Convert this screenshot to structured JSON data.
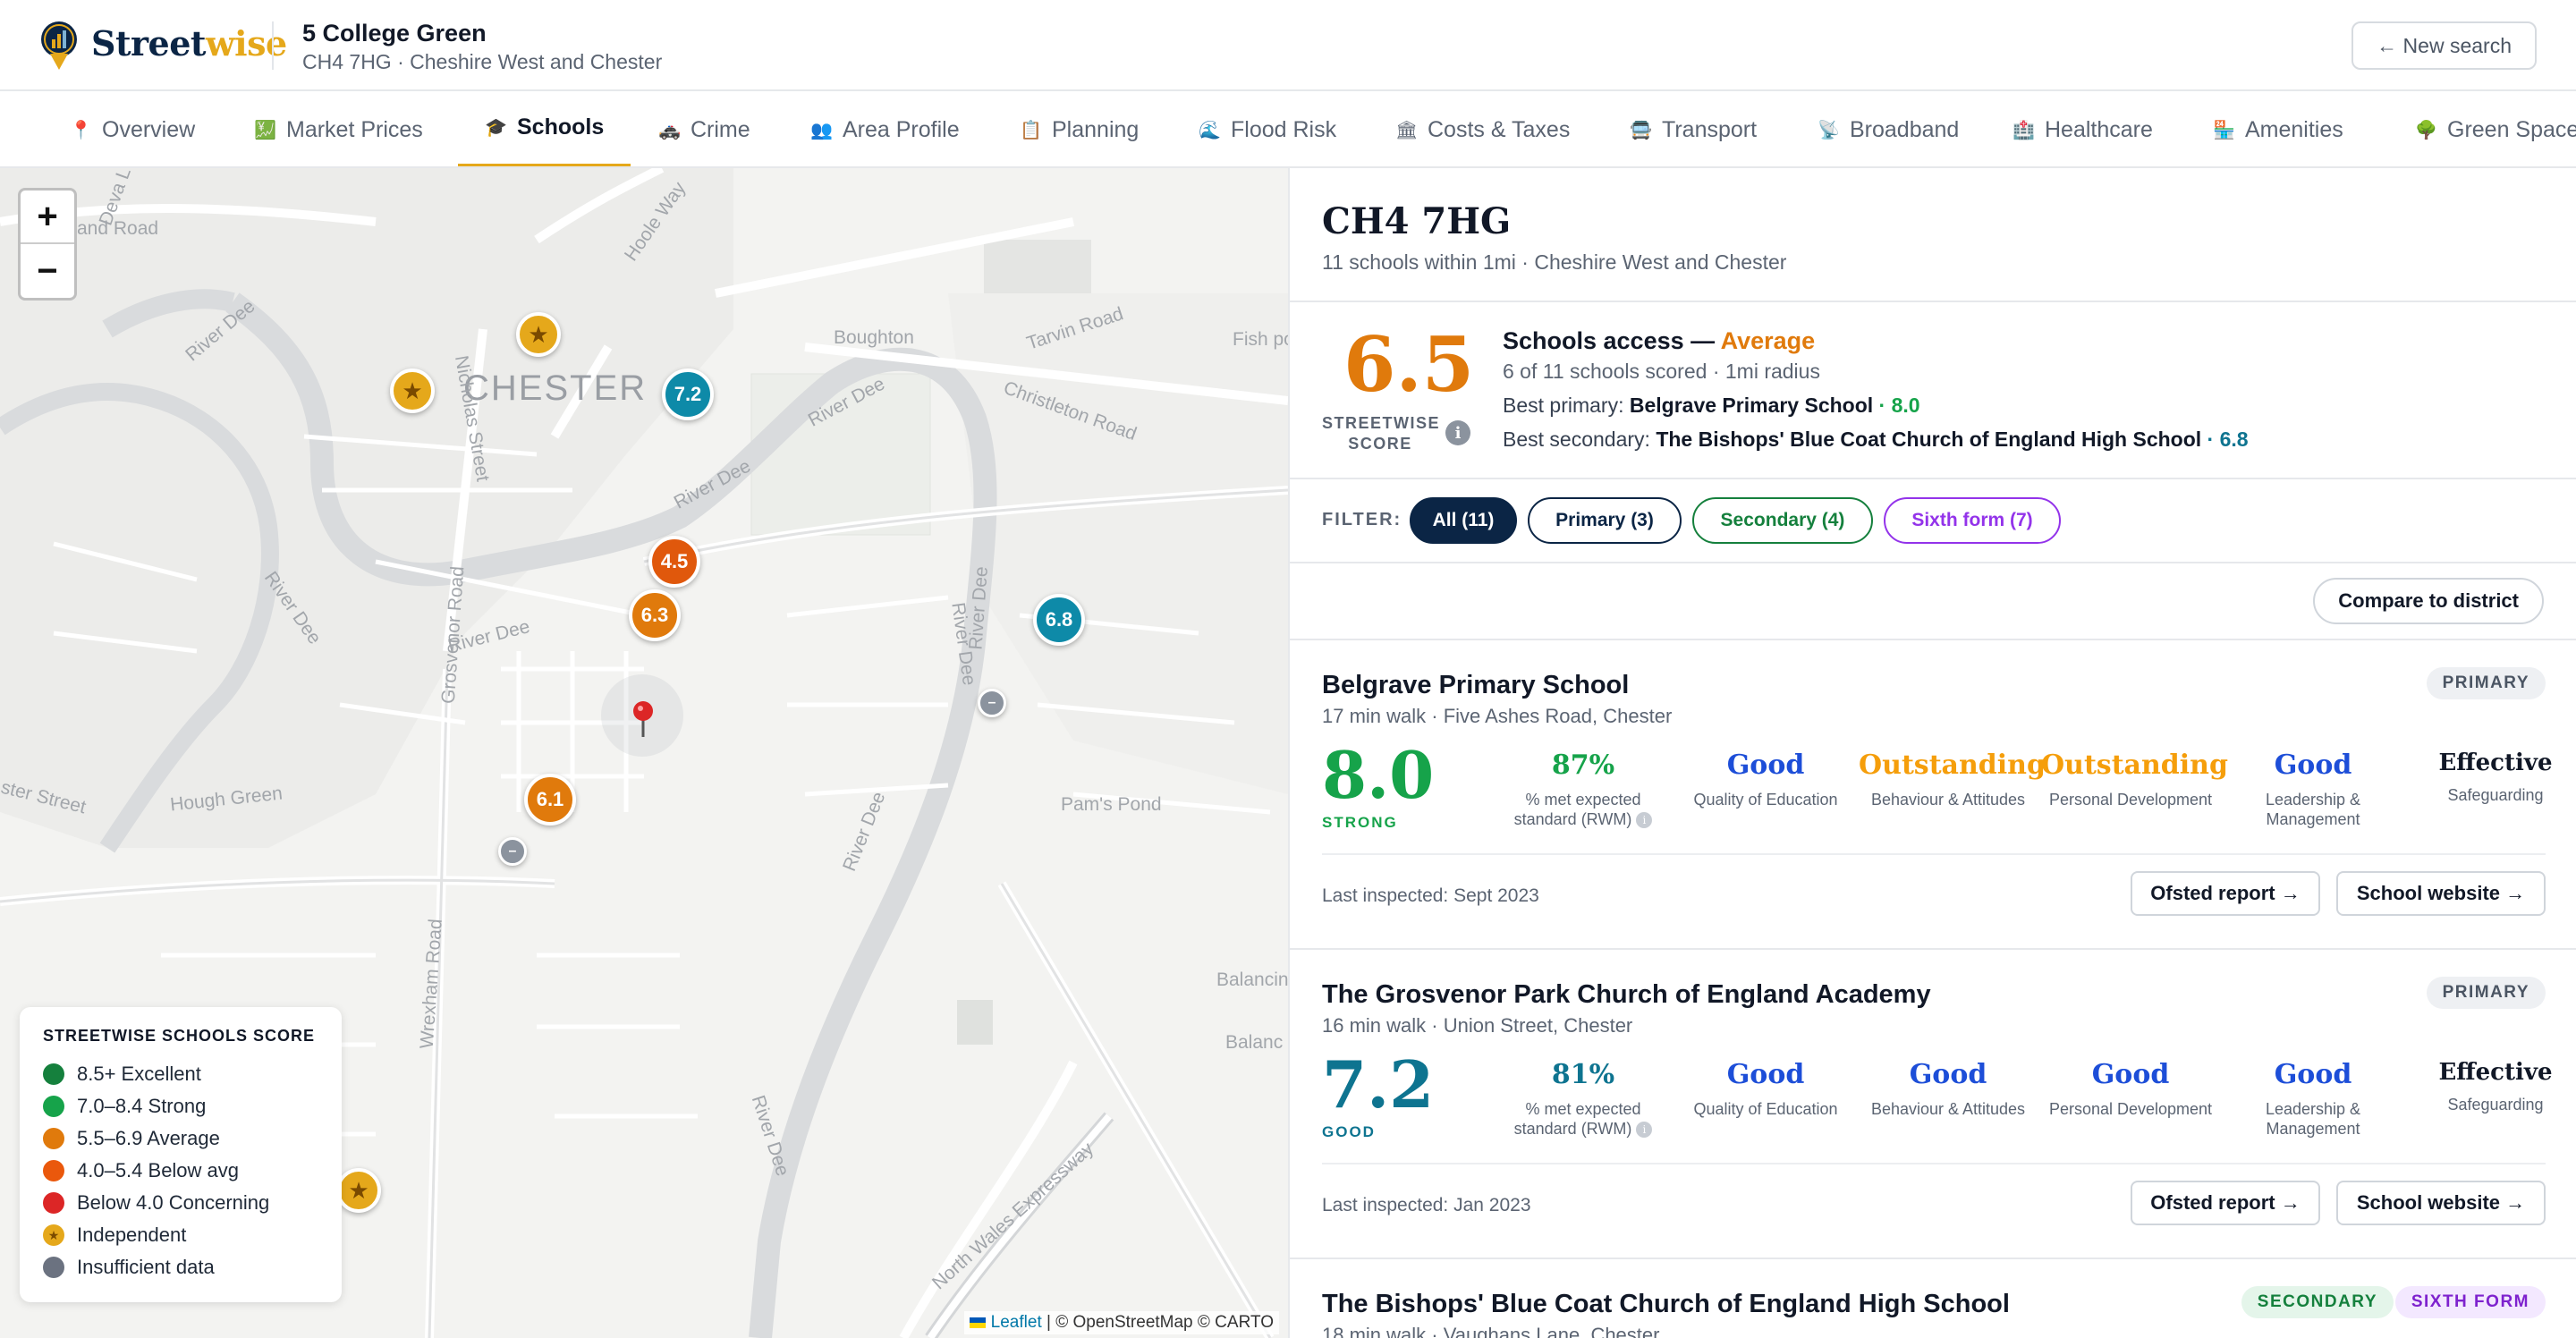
{
  "brand": {
    "name_main": "Street",
    "name_accent": "wise"
  },
  "header": {
    "title": "5 College Green",
    "subtitle": "CH4 7HG · Cheshire West and Chester",
    "new_search": "← New search"
  },
  "nav": {
    "tabs": [
      {
        "label": "Overview",
        "icon": "pin-icon",
        "glyph": "📍"
      },
      {
        "label": "Market Prices",
        "icon": "chart-icon",
        "glyph": "💹"
      },
      {
        "label": "Schools",
        "icon": "graduation-cap-icon",
        "glyph": "🎓",
        "active": true
      },
      {
        "label": "Crime",
        "icon": "police-car-icon",
        "glyph": "🚓"
      },
      {
        "label": "Area Profile",
        "icon": "people-icon",
        "glyph": "👥"
      },
      {
        "label": "Planning",
        "icon": "clipboard-icon",
        "glyph": "📋"
      },
      {
        "label": "Flood Risk",
        "icon": "water-icon",
        "glyph": "🌊"
      },
      {
        "label": "Costs & Taxes",
        "icon": "bank-icon",
        "glyph": "🏛"
      },
      {
        "label": "Transport",
        "icon": "bus-icon",
        "glyph": "🚍"
      },
      {
        "label": "Broadband",
        "icon": "satellite-icon",
        "glyph": "📡"
      },
      {
        "label": "Healthcare",
        "icon": "hospital-icon",
        "glyph": "🏥"
      },
      {
        "label": "Amenities",
        "icon": "shop-icon",
        "glyph": "🏪"
      },
      {
        "label": "Green Space",
        "icon": "tree-icon",
        "glyph": "🌳"
      }
    ]
  },
  "map": {
    "zoom_in": "+",
    "zoom_out": "−",
    "labels": {
      "chester": "CHESTER",
      "boughton": "Boughton",
      "tarvin": "Tarvin Road",
      "christleton": "Christleton Road",
      "river_dee": "River Dee",
      "hough_green": "Hough Green",
      "wrexham": "Wrexham Road",
      "grosvenor": "Grosvenor Road",
      "nicholas": "Nicholas Street",
      "hoole": "Hoole Way",
      "pams_pond": "Pam's Pond",
      "balancing": "Balancin",
      "balanc": "Balanc",
      "north_wales": "North Wales Expressway",
      "fish_pond": "Fish po",
      "land_road": "and Road",
      "ster_street": "ster Street",
      "devas": "Deva L"
    },
    "markers": [
      {
        "id": "marker-7-2",
        "label": "7.2",
        "color": "#0e8aa8"
      },
      {
        "id": "marker-4-5",
        "label": "4.5",
        "color": "#e0580c"
      },
      {
        "id": "marker-6-3",
        "label": "6.3",
        "color": "#e07a0c"
      },
      {
        "id": "marker-6-8",
        "label": "6.8",
        "color": "#0e8aa8"
      },
      {
        "id": "marker-6-1",
        "label": "6.1",
        "color": "#e07a0c"
      }
    ],
    "legend": {
      "title": "STREETWISE SCHOOLS SCORE",
      "items": [
        {
          "label": "8.5+ Excellent",
          "color": "#15803d"
        },
        {
          "label": "7.0–8.4 Strong",
          "color": "#16a34a"
        },
        {
          "label": "5.5–6.9 Average",
          "color": "#e07a0c"
        },
        {
          "label": "4.0–5.4 Below avg",
          "color": "#ea580c"
        },
        {
          "label": "Below 4.0 Concerning",
          "color": "#dc2626"
        },
        {
          "label": "Independent",
          "color": "#e5a81b"
        },
        {
          "label": "Insufficient data",
          "color": "#6b7280"
        }
      ]
    },
    "attribution": {
      "leaflet": "Leaflet",
      "rest": " | © OpenStreetMap © CARTO"
    }
  },
  "panel": {
    "postcode": "CH4 7HG",
    "summary": "11 schools within 1mi · Cheshire West and Chester",
    "score": "6.5",
    "score_label": "STREETWISE SCORE",
    "access_title": "Schools access — ",
    "access_rating": "Average",
    "access_scored": "6 of 11 schools scored · 1mi radius",
    "best_primary_label": "Best primary: ",
    "best_primary_name": "Belgrave Primary School",
    "best_primary_score": " · 8.0",
    "best_secondary_label": "Best secondary: ",
    "best_secondary_name": "The Bishops' Blue Coat Church of England High School",
    "best_secondary_score": " · 6.8",
    "filter_label": "FILTER:",
    "filters": [
      {
        "label": "All (11)"
      },
      {
        "label": "Primary (3)"
      },
      {
        "label": "Secondary (4)"
      },
      {
        "label": "Sixth form (7)"
      }
    ],
    "compare": "Compare to district"
  },
  "schools": [
    {
      "name": "Belgrave Primary School",
      "location": "17 min walk · Five Ashes Road, Chester",
      "badges": [
        "PRIMARY"
      ],
      "score": "8.0",
      "score_label": "STRONG",
      "metrics": [
        {
          "value": "87%",
          "label": "% met expected standard (RWM)"
        },
        {
          "value": "Good",
          "label": "Quality of Education"
        },
        {
          "value": "Outstanding",
          "label": "Behaviour & Attitudes"
        },
        {
          "value": "Outstanding",
          "label": "Personal Development"
        },
        {
          "value": "Good",
          "label": "Leadership & Management"
        },
        {
          "value": "Effective",
          "label": "Safeguarding"
        }
      ],
      "inspected": "Last inspected: Sept 2023",
      "ofsted": "Ofsted report →",
      "website": "School website →"
    },
    {
      "name": "The Grosvenor Park Church of England Academy",
      "location": "16 min walk · Union Street, Chester",
      "badges": [
        "PRIMARY"
      ],
      "score": "7.2",
      "score_label": "GOOD",
      "metrics": [
        {
          "value": "81%",
          "label": "% met expected standard (RWM)"
        },
        {
          "value": "Good",
          "label": "Quality of Education"
        },
        {
          "value": "Good",
          "label": "Behaviour & Attitudes"
        },
        {
          "value": "Good",
          "label": "Personal Development"
        },
        {
          "value": "Good",
          "label": "Leadership & Management"
        },
        {
          "value": "Effective",
          "label": "Safeguarding"
        }
      ],
      "inspected": "Last inspected: Jan 2023",
      "ofsted": "Ofsted report →",
      "website": "School website →"
    },
    {
      "name": "The Bishops' Blue Coat Church of England High School",
      "location": "18 min walk · Vaughans Lane, Chester",
      "badges": [
        "SECONDARY",
        "SIXTH FORM"
      ]
    }
  ]
}
